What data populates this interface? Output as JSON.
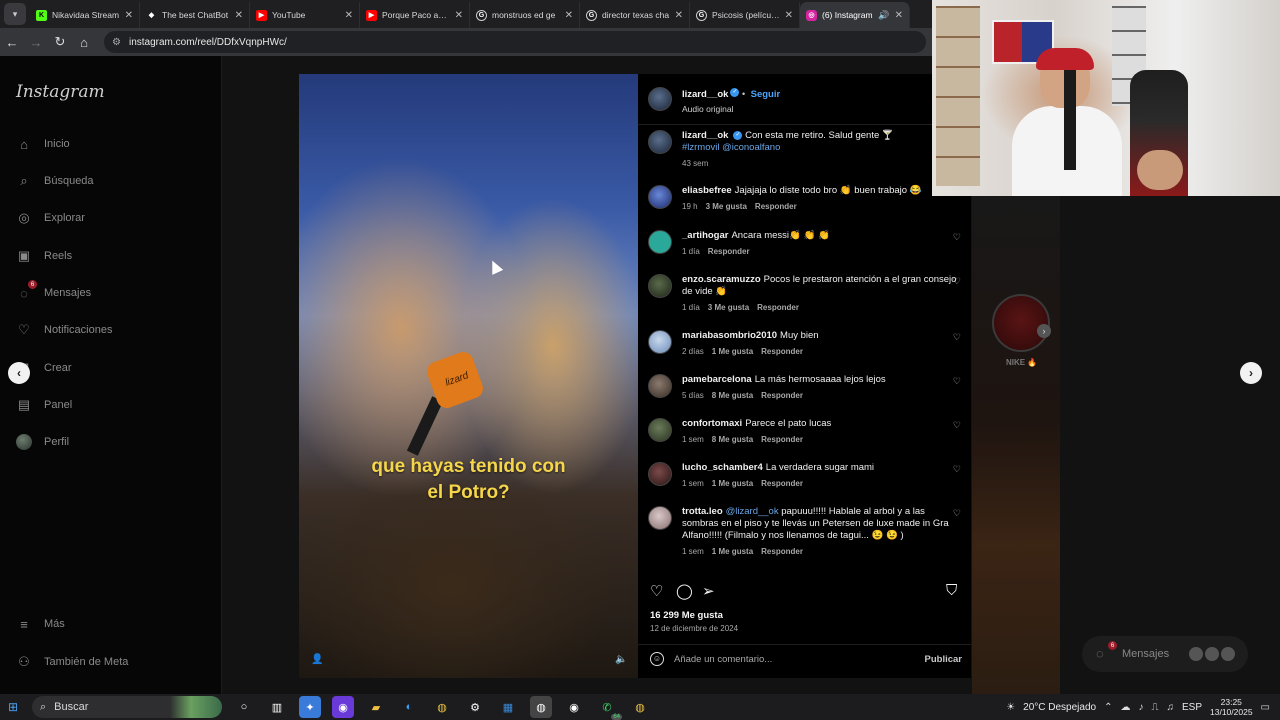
{
  "browser": {
    "tabs": [
      {
        "label": "Nikavidaa Stream",
        "icon": "kick-icon",
        "color": "#53fc18",
        "active": false
      },
      {
        "label": "The best ChatBot",
        "icon": "chatbot-icon",
        "color": "#ffffff",
        "active": false
      },
      {
        "label": "YouTube",
        "icon": "youtube-icon",
        "color": "#ff0000",
        "active": false
      },
      {
        "label": "Porque Paco amo",
        "icon": "youtube-icon",
        "color": "#ff0000",
        "active": false
      },
      {
        "label": "monstruos ed ge",
        "icon": "google-icon",
        "color": "#ffffff",
        "active": false
      },
      {
        "label": "director texas cha",
        "icon": "google-icon",
        "color": "#ffffff",
        "active": false
      },
      {
        "label": "Psicosis (película)",
        "icon": "google-icon",
        "color": "#ffffff",
        "active": false
      },
      {
        "label": "(6) Instagram",
        "icon": "instagram-icon",
        "color": "#d6249f",
        "active": true
      }
    ],
    "url": "instagram.com/reel/DDfxVqnpHWc/"
  },
  "instagram": {
    "logo": "Instagram",
    "nav": [
      {
        "label": "Inicio",
        "icon": "home-icon"
      },
      {
        "label": "Búsqueda",
        "icon": "search-icon"
      },
      {
        "label": "Explorar",
        "icon": "compass-icon"
      },
      {
        "label": "Reels",
        "icon": "reels-icon"
      },
      {
        "label": "Mensajes",
        "icon": "messenger-icon",
        "badge": "6"
      },
      {
        "label": "Notificaciones",
        "icon": "heart-icon"
      },
      {
        "label": "Crear",
        "icon": "plus-icon"
      },
      {
        "label": "Panel",
        "icon": "chart-icon"
      },
      {
        "label": "Perfil",
        "icon": "avatar"
      }
    ],
    "bottom_nav": [
      {
        "label": "Más",
        "icon": "menu-icon"
      },
      {
        "label": "También de Meta",
        "icon": "meta-icon"
      }
    ],
    "video": {
      "caption_line1": "que hayas tenido con",
      "caption_line2": "el Potro?",
      "mic_logo": "lizard"
    },
    "post": {
      "author": "lizard__ok",
      "follow": "Seguir",
      "audio": "Audio original",
      "caption_text": "Con esta me retiro. Salud gente 🍸",
      "caption_tags": "#lzrmovil @iconoalfano",
      "caption_age": "43 sem",
      "likes": "16 299 Me gusta",
      "date": "12 de diciembre de 2024",
      "add_comment_placeholder": "Añade un comentario...",
      "publish": "Publicar",
      "reply": "Responder"
    },
    "comments": [
      {
        "user": "eliasbefree",
        "text": "Jajajaja lo diste todo bro 👏 buen trabajo 😂",
        "age": "19 h",
        "likes": "3 Me gusta"
      },
      {
        "user": "_artihogar",
        "text": "Ancara messi👏 👏 👏",
        "age": "1 día",
        "likes": ""
      },
      {
        "user": "enzo.scaramuzzo",
        "text": "Pocos le prestaron atención a el gran consejo de vide 👏",
        "age": "1 día",
        "likes": "3 Me gusta"
      },
      {
        "user": "mariabasombrio2010",
        "text": "Muy bien",
        "age": "2 días",
        "likes": "1 Me gusta"
      },
      {
        "user": "pamebarcelona",
        "text": "La más hermosaaaa lejos lejos",
        "age": "5 días",
        "likes": "8 Me gusta"
      },
      {
        "user": "confortomaxi",
        "text": "Parece el pato lucas",
        "age": "1 sem",
        "likes": "8 Me gusta"
      },
      {
        "user": "lucho_schamber4",
        "text": "La verdadera sugar mami",
        "age": "1 sem",
        "likes": "1 Me gusta"
      },
      {
        "user": "trotta.leo",
        "mention": "@lizard__ok",
        "text": "papuuu!!!!! Hablale al arbol y a las sombras en el piso y te llevás un Petersen de luxe made in Gra Alfano!!!!! (Filmalo y nos llenamos de tagui... 😉 😉 )",
        "age": "1 sem",
        "likes": "1 Me gusta"
      }
    ],
    "side_story_label": "NIKE 🔥",
    "messages_pill": "Mensajes",
    "messages_badge": "6"
  },
  "taskbar": {
    "search": "Buscar",
    "weather": "20°C Despejado",
    "lang": "ESP",
    "time": "23:25",
    "date": "13/10/2025",
    "whatsapp_badge": "64"
  }
}
